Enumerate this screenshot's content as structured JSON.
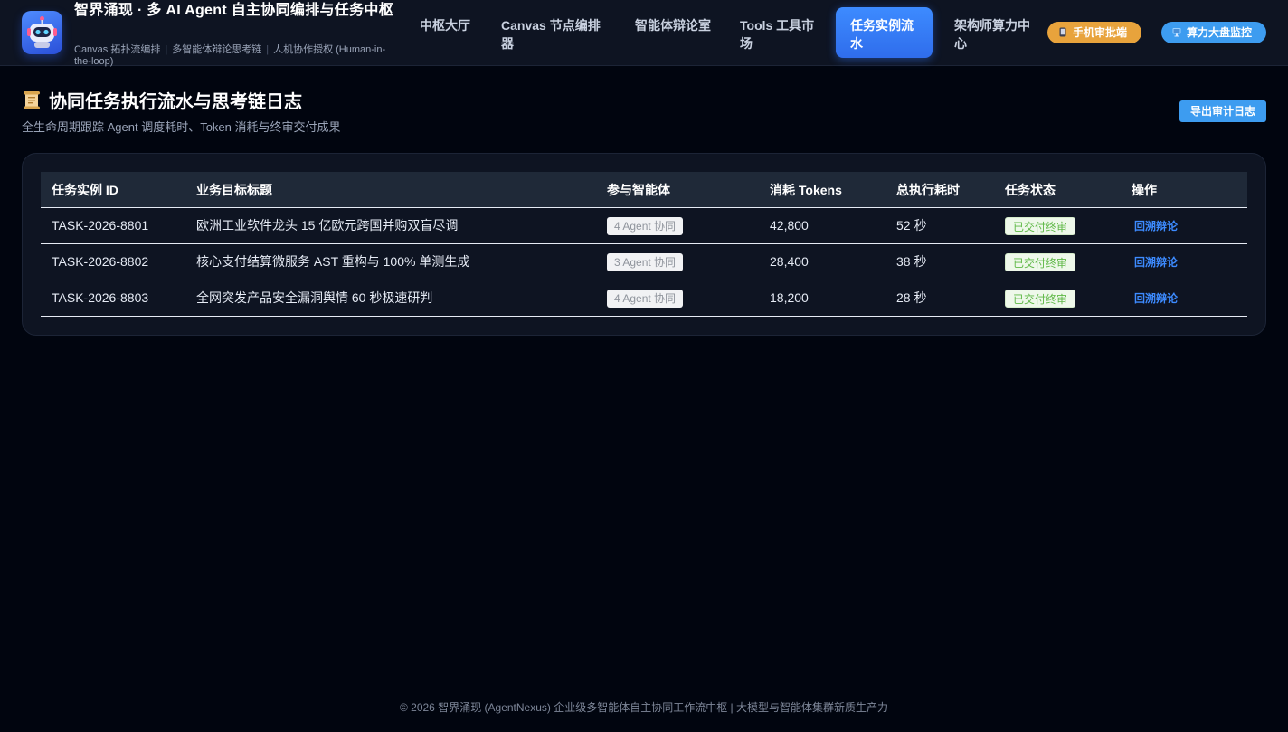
{
  "header": {
    "brand_title": "智界涌现 · 多 AI Agent 自主协同编排与任务中枢",
    "brand_sub": [
      "Canvas 拓扑流编排",
      "多智能体辩论思考链",
      "人机协作授权 (Human-in-the-loop)"
    ],
    "nav": [
      {
        "label": "中枢大厅",
        "active": false
      },
      {
        "label": "Canvas 节点编排器",
        "active": false
      },
      {
        "label": "智能体辩论室",
        "active": false
      },
      {
        "label": "Tools 工具市场",
        "active": false
      },
      {
        "label": "任务实例流水",
        "active": true
      },
      {
        "label": "架构师算力中心",
        "active": false
      }
    ],
    "mobile_pill": {
      "label": "手机审批端",
      "icon": "mobile-icon",
      "color": "#e8a33c"
    },
    "screen_pill": {
      "label": "算力大盘监控",
      "icon": "monitor-icon",
      "color": "#3d9cf0"
    }
  },
  "page": {
    "title": "协同任务执行流水与思考链日志",
    "title_icon": "scroll-icon",
    "subtitle": "全生命周期跟踪 Agent 调度耗时、Token 消耗与终审交付成果",
    "export_label": "导出审计日志"
  },
  "table": {
    "columns": [
      "任务实例 ID",
      "业务目标标题",
      "参与智能体",
      "消耗 Tokens",
      "总执行耗时",
      "任务状态",
      "操作"
    ],
    "rows": [
      {
        "id": "TASK-2026-8801",
        "title": "欧洲工业软件龙头 15 亿欧元跨国并购双盲尽调",
        "agents": "4 Agent 协同",
        "tokens": "42,800",
        "duration": "52 秒",
        "status": "已交付终审",
        "action": "回溯辩论"
      },
      {
        "id": "TASK-2026-8802",
        "title": "核心支付结算微服务 AST 重构与 100% 单测生成",
        "agents": "3 Agent 协同",
        "tokens": "28,400",
        "duration": "38 秒",
        "status": "已交付终审",
        "action": "回溯辩论"
      },
      {
        "id": "TASK-2026-8803",
        "title": "全网突发产品安全漏洞舆情 60 秒极速研判",
        "agents": "4 Agent 协同",
        "tokens": "18,200",
        "duration": "28 秒",
        "status": "已交付终审",
        "action": "回溯辩论"
      }
    ]
  },
  "footer": {
    "text": "© 2026 智界涌现 (AgentNexus) 企业级多智能体自主协同工作流中枢 | 大模型与智能体集群新质生产力"
  },
  "colors": {
    "background": "#01050f",
    "header": "#0e1422",
    "accent": "#3d8bff",
    "status_green": "#5fb847"
  }
}
